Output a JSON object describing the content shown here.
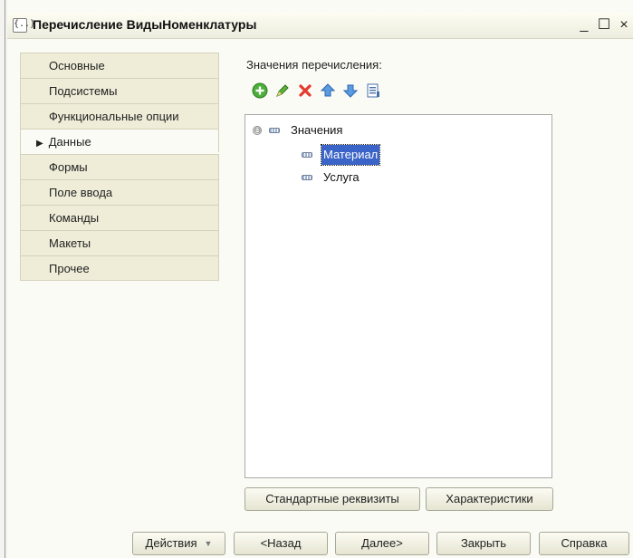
{
  "window": {
    "title": "Перечисление ВидыНоменклатуры",
    "icon_glyph": "{..}",
    "minimize_glyph": "_",
    "maximize_glyph": "☐",
    "close_glyph": "×"
  },
  "sidebar": {
    "items": [
      {
        "label": "Основные"
      },
      {
        "label": "Подсистемы"
      },
      {
        "label": "Функциональные опции"
      },
      {
        "label": "Данные",
        "active": true
      },
      {
        "label": "Формы"
      },
      {
        "label": "Поле ввода"
      },
      {
        "label": "Команды"
      },
      {
        "label": "Макеты"
      },
      {
        "label": "Прочее"
      }
    ],
    "active_marker": "▶"
  },
  "main": {
    "section_label": "Значения перечисления:",
    "toolbar_icons": [
      "add-icon",
      "edit-icon",
      "delete-icon",
      "move-up-icon",
      "move-down-icon",
      "sort-list-icon"
    ],
    "tree": {
      "root": {
        "label": "Значения",
        "toggle": "⊖"
      },
      "children": [
        {
          "label": "Материал",
          "selected": true
        },
        {
          "label": "Услуга"
        }
      ]
    },
    "buttons": {
      "standard_attributes": "Стандартные реквизиты",
      "characteristics": "Характеристики"
    }
  },
  "footer": {
    "actions": "Действия",
    "back": "<Назад",
    "next": "Далее>",
    "close": "Закрыть",
    "help": "Справка"
  },
  "colors": {
    "selection": "#3a64c7",
    "sidebar_bg": "#efedd8",
    "window_bg": "#fbfbf5"
  }
}
